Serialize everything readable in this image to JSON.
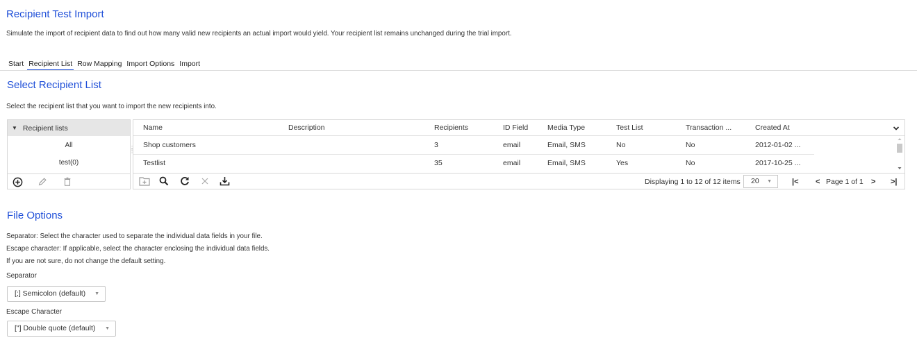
{
  "page": {
    "title": "Recipient Test Import",
    "intro": "Simulate the import of recipient data to find out how many valid new recipients an actual import would yield. Your recipient list remains unchanged during the trial import."
  },
  "tabs": [
    {
      "label": "Start",
      "active": false
    },
    {
      "label": "Recipient List",
      "active": true
    },
    {
      "label": "Row Mapping",
      "active": false
    },
    {
      "label": "Import Options",
      "active": false
    },
    {
      "label": "Import",
      "active": false
    }
  ],
  "select_section": {
    "title": "Select Recipient List",
    "hint": "Select the recipient list that you want to import the new recipients into."
  },
  "tree": {
    "header": "Recipient lists",
    "items": [
      "All",
      "test(0)"
    ],
    "footer_icons": [
      "add-circle-icon",
      "edit-pencil-icon",
      "delete-trash-icon"
    ]
  },
  "grid": {
    "columns": [
      "Name",
      "Description",
      "Recipients",
      "ID Field",
      "Media Type",
      "Test List",
      "Transaction ...",
      "Created At"
    ],
    "rows": [
      [
        "Shop customers",
        "",
        "3",
        "email",
        "Email, SMS",
        "No",
        "No",
        "2012-01-02 ..."
      ],
      [
        "Testlist",
        "",
        "35",
        "email",
        "Email, SMS",
        "Yes",
        "No",
        "2017-10-25 ..."
      ]
    ],
    "toolbar_icons": [
      "new-folder-icon",
      "search-icon",
      "refresh-icon",
      "clear-icon",
      "export-icon"
    ],
    "display_text": "Displaying 1 to 12 of 12 items",
    "page_size": "20",
    "page_text": "Page 1 of 1",
    "first_glyph": "|<",
    "prev_glyph": "<",
    "next_glyph": ">",
    "last_glyph": ">|"
  },
  "file_options": {
    "title": "File Options",
    "lines": [
      "Separator: Select the character used to separate the individual data fields in your file.",
      "Escape character: If applicable, select the character enclosing the individual data fields.",
      "If you are not sure, do not change the default setting."
    ],
    "separator_label": "Separator",
    "separator_value": "[;] Semicolon (default)",
    "escape_label": "Escape Character",
    "escape_value": "[\"] Double quote (default)"
  },
  "colors": {
    "accent": "#1f4fd8",
    "border": "#d7d7d7",
    "tree_header_bg": "#e6e6e6"
  }
}
